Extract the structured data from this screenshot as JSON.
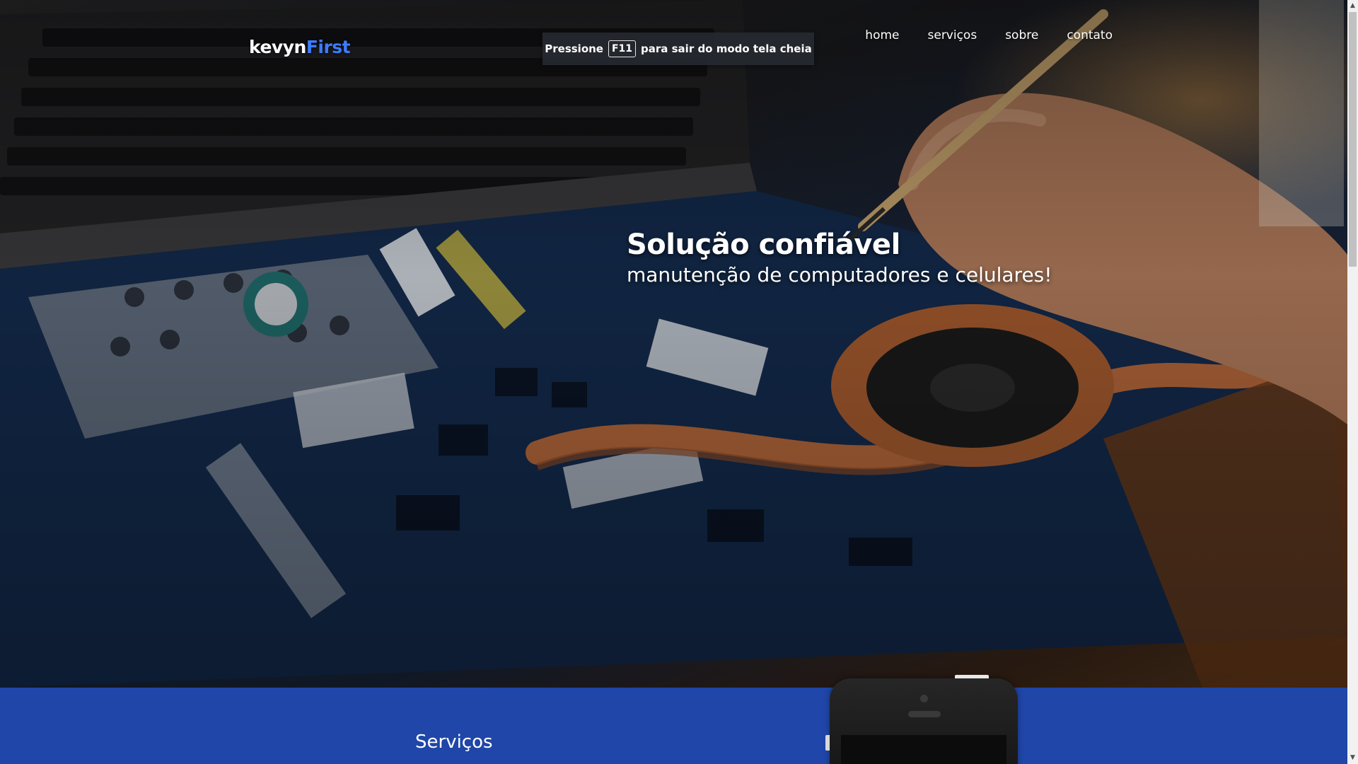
{
  "brand": {
    "part1": "kevyn",
    "part2": "First",
    "accent_color": "#3d7bff"
  },
  "nav": {
    "items": [
      {
        "label": "home"
      },
      {
        "label": "serviços"
      },
      {
        "label": "sobre"
      },
      {
        "label": "contato"
      }
    ]
  },
  "fullscreen_notice": {
    "prefix": "Pressione",
    "key": "F11",
    "suffix": "para sair do modo tela cheia"
  },
  "hero": {
    "title": "Solução confiável",
    "subtitle": "manutenção de computadores e celulares!",
    "image": "laptop-repair-photo"
  },
  "services": {
    "title": "Serviços",
    "background_color": "#1f46a8",
    "image": "smartphone-icon"
  },
  "scrollbar": {
    "up_icon": "arrow-up-icon",
    "down_icon": "arrow-down-icon"
  }
}
